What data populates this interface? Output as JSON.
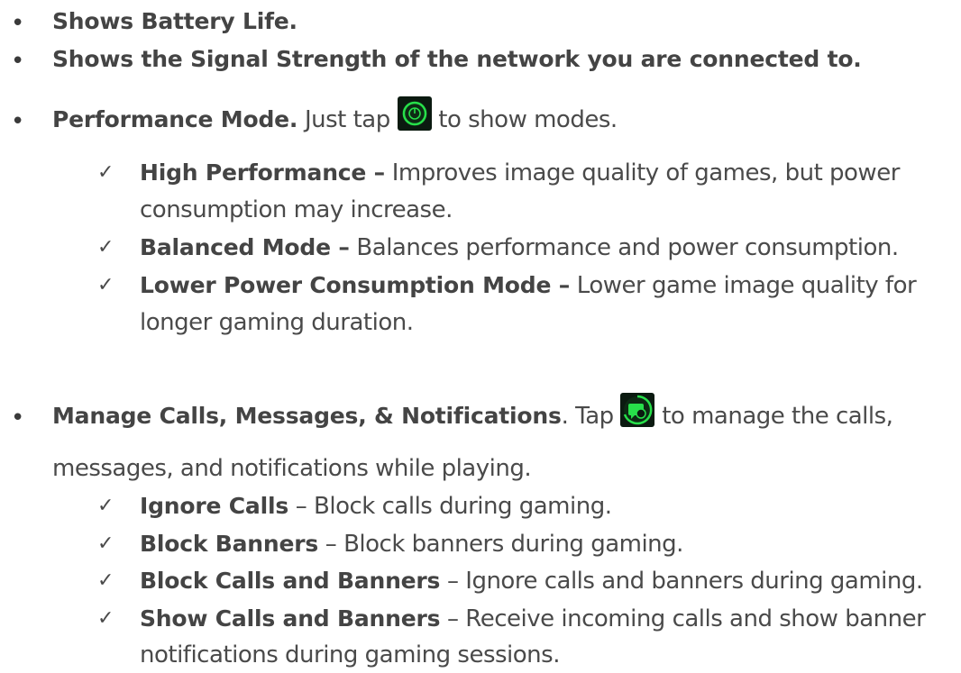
{
  "bullets": {
    "battery": "Shows Battery Life.",
    "signal": "Shows the Signal Strength of the network you are connected to.",
    "performance": {
      "title": "Performance Mode.",
      "text_before_icon": " Just tap ",
      "text_after_icon": " to show modes.",
      "icon": "performance-mode-icon",
      "modes": [
        {
          "name": "High Performance –",
          "desc": " Improves image quality of games, but power",
          "desc_cont": "consumption may increase."
        },
        {
          "name": "Balanced Mode –",
          "desc": " Balances performance and power consumption."
        },
        {
          "name": "Lower Power Consumption Mode –",
          "desc": " Lower game image quality for",
          "desc_cont": "longer gaming duration."
        }
      ]
    },
    "calls": {
      "title": "Manage Calls, Messages, & Notifications",
      "text_before_icon": ". Tap ",
      "text_after_icon": " to manage the calls,",
      "text_cont": "messages, and notifications while playing.",
      "icon": "manage-calls-icon",
      "options": [
        {
          "name": "Ignore Calls",
          "desc": " – Block calls during gaming."
        },
        {
          "name": "Block Banners",
          "desc": " – Block banners during gaming."
        },
        {
          "name": "Block Calls and Banners",
          "desc": " – Ignore calls and banners during gaming."
        },
        {
          "name": "Show Calls and Banners",
          "desc": " – Receive incoming calls and show banner",
          "desc_cont": "notifications during gaming sessions."
        }
      ]
    }
  },
  "colors": {
    "text": "#4a4a4a",
    "icon_green": "#27e04a",
    "icon_bg": "#0b1a10"
  }
}
